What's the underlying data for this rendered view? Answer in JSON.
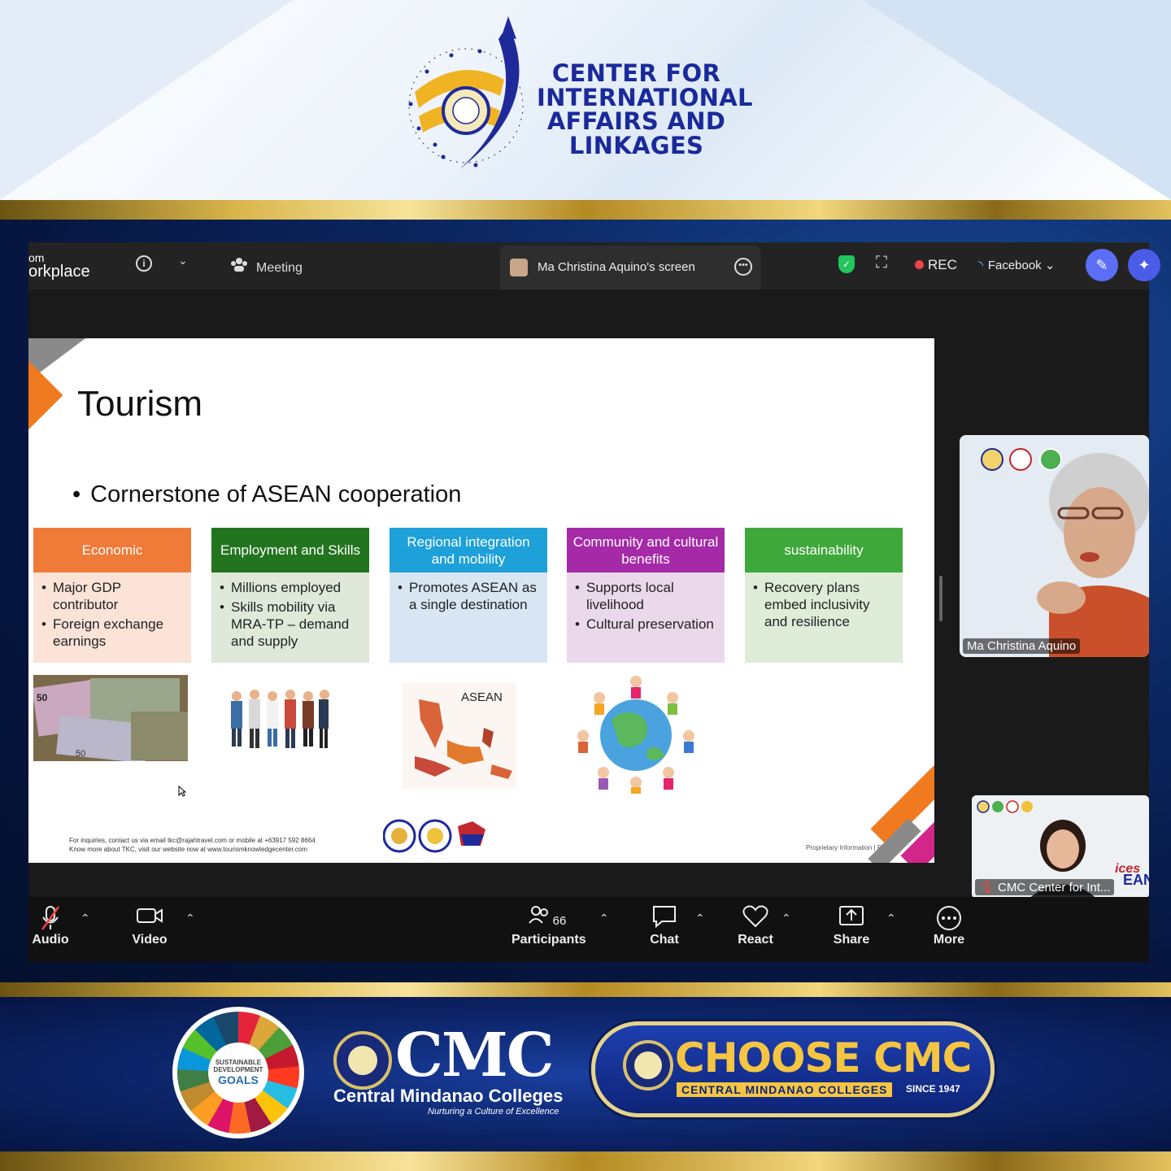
{
  "header": {
    "org_title": "CENTER FOR INTERNATIONAL AFFAIRS AND LINKAGES"
  },
  "zoom": {
    "brand_line1": "om",
    "brand_line2": "orkplace",
    "meeting_label": "Meeting",
    "share_tab_label": "Ma Christina Aquino's screen",
    "rec_label": "REC",
    "live_label": "Facebook",
    "colors": {
      "rec": "#ef4444",
      "shield": "#22c55e",
      "accent": "#5b6ef5"
    }
  },
  "slide": {
    "title": "Tourism",
    "bullet": "Cornerstone of ASEAN cooperation",
    "cards": [
      {
        "header": "Economic",
        "color": "#f07a38",
        "body_color": "#fbe3d8",
        "items": [
          "Major GDP contributor",
          "Foreign exchange earnings"
        ]
      },
      {
        "header": "Employment and Skills",
        "color": "#23741f",
        "body_color": "#dfe8d9",
        "items": [
          "Millions employed",
          "Skills mobility via MRA-TP – demand and supply"
        ]
      },
      {
        "header": "Regional integration and mobility",
        "color": "#1ea0d9",
        "body_color": "#d7e6f2",
        "items": [
          "Promotes ASEAN as a single destination"
        ]
      },
      {
        "header": "Community and cultural benefits",
        "color": "#a52aa8",
        "body_color": "#ead9ea",
        "items": [
          "Supports local livelihood",
          "Cultural preservation"
        ]
      },
      {
        "header": "sustainability",
        "color": "#3fa83a",
        "body_color": "#deecd8",
        "items": [
          "Recovery plans embed inclusivity and resilience"
        ]
      }
    ],
    "asean_map_label": "ASEAN",
    "footer_line1": "For inquiries, contact us via email tkc@rajahtravel.com or mobile at +63917 592 8664",
    "footer_line2": "Know more about TKC, visit our website now at www.tourismknowledgecenter.com",
    "footer_email": "tkc@rajahtravel.com",
    "footer_site": "www.tourismknowledgecenter.com",
    "proprietary": "Proprietary Information | Pg."
  },
  "videos": {
    "presenter_name": "Ma Christina Aquino",
    "second_name": "CMC Center for Int..."
  },
  "controls": {
    "audio": "Audio",
    "video": "Video",
    "participants": "Participants",
    "participants_count": "66",
    "chat": "Chat",
    "react": "React",
    "share": "Share",
    "more": "More"
  },
  "footer": {
    "sdg_small": "SUSTAINABLE DEVELOPMENT",
    "sdg_goals": "GOALS",
    "cmc_logo": "CMC",
    "cmc_name": "Central Mindanao Colleges",
    "cmc_tagline": "Nurturing a Culture of Excellence",
    "choose_title": "CHOOSE CMC",
    "choose_sub": "CENTRAL MINDANAO COLLEGES",
    "since": "SINCE 1947"
  }
}
